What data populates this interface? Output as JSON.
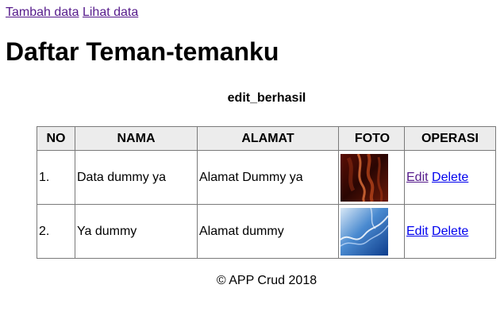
{
  "nav": {
    "links": [
      {
        "label": "Tambah data"
      },
      {
        "label": "Lihat data"
      }
    ]
  },
  "page_title": "Daftar Teman-temanku",
  "flash_message": "edit_berhasil",
  "table": {
    "headers": [
      "NO",
      "NAMA",
      "ALAMAT",
      "FOTO",
      "OPERASI"
    ],
    "rows": [
      {
        "no": "1.",
        "nama": "Data dummy ya",
        "alamat": "Alamat Dummy ya",
        "foto": "red-abstract-photo",
        "edit": "Edit",
        "delete": "Delete"
      },
      {
        "no": "2.",
        "nama": "Ya dummy",
        "alamat": "Alamat dummy",
        "foto": "blue-abstract-photo",
        "edit": "Edit",
        "delete": "Delete"
      }
    ]
  },
  "footer": "© APP Crud 2018",
  "colors": {
    "visited_link": "#551a8b",
    "link": "#0000ee",
    "header_bg": "#ececec"
  }
}
